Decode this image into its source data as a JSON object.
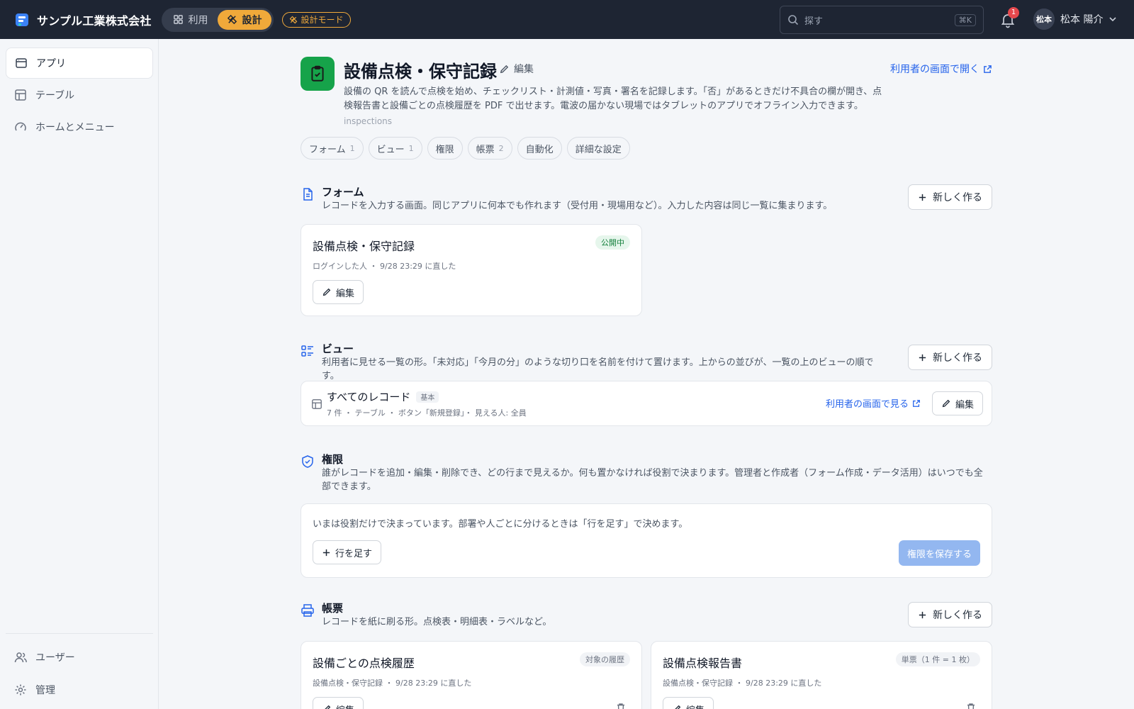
{
  "topbar": {
    "company": "サンプル工業株式会社",
    "mode_use": "利用",
    "mode_design": "設計",
    "design_mode_pill": "設計モード",
    "search_placeholder": "探す",
    "search_shortcut": "⌘K",
    "notification_count": "1",
    "avatar_text": "松本",
    "user_name": "松本 陽介"
  },
  "sidebar": {
    "items": [
      {
        "label": "アプリ"
      },
      {
        "label": "テーブル"
      },
      {
        "label": "ホームとメニュー"
      }
    ],
    "bottom": [
      {
        "label": "ユーザー"
      },
      {
        "label": "管理"
      }
    ]
  },
  "app": {
    "title": "設備点検・保守記録",
    "edit_label": "編集",
    "open_user_screen": "利用者の画面で開く",
    "description": "設備の QR を読んで点検を始め、チェックリスト・計測値・写真・署名を記録します。「否」があるときだけ不具合の欄が開き、点検報告書と設備ごとの点検履歴を PDF で出せます。電波の届かない現場ではタブレットのアプリでオフライン入力できます。",
    "slug": "inspections"
  },
  "tabs": [
    {
      "label": "フォーム",
      "count": "1"
    },
    {
      "label": "ビュー",
      "count": "1"
    },
    {
      "label": "権限",
      "count": ""
    },
    {
      "label": "帳票",
      "count": "2"
    },
    {
      "label": "自動化",
      "count": ""
    },
    {
      "label": "詳細な設定",
      "count": ""
    }
  ],
  "forms": {
    "title": "フォーム",
    "description": "レコードを入力する画面。同じアプリに何本でも作れます（受付用・現場用など）。入力した内容は同じ一覧に集まります。",
    "new_label": "新しく作る",
    "card": {
      "title": "設備点検・保守記録",
      "badge": "公開中",
      "meta": "ログインした人 ・ 9/28 23:29 に直した",
      "edit_label": "編集"
    }
  },
  "views": {
    "title": "ビュー",
    "description": "利用者に見せる一覧の形。「未対応」「今月の分」のような切り口を名前を付けて置けます。上からの並びが、一覧の上のビューの順です。",
    "new_label": "新しく作る",
    "row": {
      "title": "すべてのレコード",
      "badge": "基本",
      "meta": "7 件 ・ テーブル ・ ボタン「新規登録」・ 見える人: 全員",
      "view_link": "利用者の画面で見る",
      "edit_label": "編集"
    }
  },
  "permissions": {
    "title": "権限",
    "description": "誰がレコードを追加・編集・削除でき、どの行まで見えるか。何も置かなければ役割で決まります。管理者と作成者（フォーム作成・データ活用）はいつでも全部できます。",
    "body_text": "いまは役割だけで決まっています。部署や人ごとに分けるときは「行を足す」で決めます。",
    "add_row_label": "行を足す",
    "save_label": "権限を保存する"
  },
  "reports": {
    "title": "帳票",
    "description": "レコードを紙に刷る形。点検表・明細表・ラベルなど。",
    "new_label": "新しく作る",
    "cards": [
      {
        "title": "設備ごとの点検履歴",
        "badge": "対象の履歴",
        "meta": "設備点検・保守記録 ・ 9/28 23:29 に直した",
        "edit_label": "編集"
      },
      {
        "title": "設備点検報告書",
        "badge": "単票（1 件 = 1 枚）",
        "meta": "設備点検・保守記録 ・ 9/28 23:29 に直した",
        "edit_label": "編集"
      }
    ]
  },
  "colors": {
    "topbar_bg": "#1e2533",
    "accent_orange": "#f0a93a",
    "app_icon_green": "#16a34a",
    "link_blue": "#2563eb",
    "published_green": "#15803d"
  }
}
